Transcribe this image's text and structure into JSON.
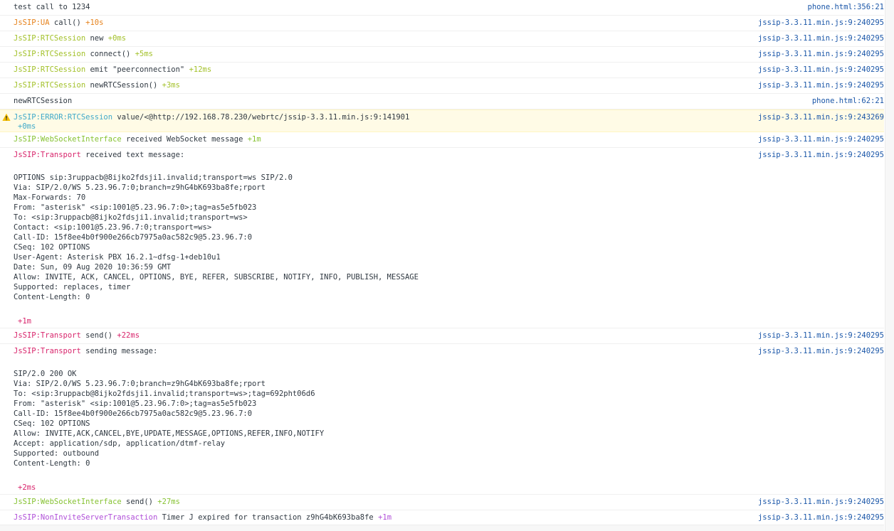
{
  "colors": {
    "ns": "#dba30b",
    "ua": "#e6821c",
    "rtc": "#a3c12a",
    "transport": "#d8246b",
    "ws": "#86c232",
    "nist": "#b04fd8",
    "err": "#3fa9c9",
    "src": "#1a56a8"
  },
  "rows": [
    {
      "text": "test call to 1234",
      "source": "phone.html:356:21"
    },
    {
      "ns": "JsSIP:UA",
      "ns_color": "ua",
      "text": " call() ",
      "delta": "+10s",
      "source": "jssip-3.3.11.min.js:9:240295"
    },
    {
      "ns": "JsSIP:RTCSession",
      "ns_color": "rtc",
      "text": " new ",
      "delta": "+0ms",
      "source": "jssip-3.3.11.min.js:9:240295"
    },
    {
      "ns": "JsSIP:RTCSession",
      "ns_color": "rtc",
      "text": " connect() ",
      "delta": "+5ms",
      "source": "jssip-3.3.11.min.js:9:240295"
    },
    {
      "ns": "JsSIP:RTCSession",
      "ns_color": "rtc",
      "text": " emit \"peerconnection\" ",
      "delta": "+12ms",
      "source": "jssip-3.3.11.min.js:9:240295"
    },
    {
      "ns": "JsSIP:RTCSession",
      "ns_color": "rtc",
      "text": " newRTCSession() ",
      "delta": "+3ms",
      "source": "jssip-3.3.11.min.js:9:240295"
    },
    {
      "text": "newRTCSession",
      "source": "phone.html:62:21"
    },
    {
      "warn": true,
      "ns": "JsSIP:ERROR:RTCSession",
      "ns_color": "err",
      "text": " value/<@http://192.168.78.230/webrtc/jssip-3.3.11.min.js:9:141901",
      "cont_delta": "+0ms",
      "source": "jssip-3.3.11.min.js:9:243269"
    },
    {
      "ns": "JsSIP:WebSocketInterface",
      "ns_color": "ws",
      "text": " received WebSocket message ",
      "delta": "+1m",
      "source": "jssip-3.3.11.min.js:9:240295"
    },
    {
      "ns": "JsSIP:Transport",
      "ns_color": "transport",
      "text": " received text message:",
      "source": "jssip-3.3.11.min.js:9:240295",
      "block": "\nOPTIONS sip:3ruppacb@8ijko2fdsji1.invalid;transport=ws SIP/2.0\nVia: SIP/2.0/WS 5.23.96.7:0;branch=z9hG4bK693ba8fe;rport\nMax-Forwards: 70\nFrom: \"asterisk\" <sip:1001@5.23.96.7:0>;tag=as5e5fb023\nTo: <sip:3ruppacb@8ijko2fdsji1.invalid;transport=ws>\nContact: <sip:1001@5.23.96.7:0;transport=ws>\nCall-ID: 15f8ee4b0f900e266cb7975a0ac582c9@5.23.96.7:0\nCSeq: 102 OPTIONS\nUser-Agent: Asterisk PBX 16.2.1~dfsg-1+deb10u1\nDate: Sun, 09 Aug 2020 10:36:59 GMT\nAllow: INVITE, ACK, CANCEL, OPTIONS, BYE, REFER, SUBSCRIBE, NOTIFY, INFO, PUBLISH, MESSAGE\nSupported: replaces, timer\nContent-Length: 0\n\n",
      "after_delta": "+1m"
    },
    {
      "ns": "JsSIP:Transport",
      "ns_color": "transport",
      "text": " send() ",
      "delta": "+22ms",
      "source": "jssip-3.3.11.min.js:9:240295"
    },
    {
      "ns": "JsSIP:Transport",
      "ns_color": "transport",
      "text": " sending message:",
      "source": "jssip-3.3.11.min.js:9:240295",
      "block": "\nSIP/2.0 200 OK\nVia: SIP/2.0/WS 5.23.96.7:0;branch=z9hG4bK693ba8fe;rport\nTo: <sip:3ruppacb@8ijko2fdsji1.invalid;transport=ws>;tag=692pht06d6\nFrom: \"asterisk\" <sip:1001@5.23.96.7:0>;tag=as5e5fb023\nCall-ID: 15f8ee4b0f900e266cb7975a0ac582c9@5.23.96.7:0\nCSeq: 102 OPTIONS\nAllow: INVITE,ACK,CANCEL,BYE,UPDATE,MESSAGE,OPTIONS,REFER,INFO,NOTIFY\nAccept: application/sdp, application/dtmf-relay\nSupported: outbound\nContent-Length: 0\n\n",
      "after_delta": "+2ms"
    },
    {
      "ns": "JsSIP:WebSocketInterface",
      "ns_color": "ws",
      "text": " send() ",
      "delta": "+27ms",
      "source": "jssip-3.3.11.min.js:9:240295"
    },
    {
      "ns": "JsSIP:NonInviteServerTransaction",
      "ns_color": "nist",
      "text": " Timer J expired for transaction z9hG4bK693ba8fe ",
      "delta": "+1m",
      "source": "jssip-3.3.11.min.js:9:240295"
    }
  ]
}
